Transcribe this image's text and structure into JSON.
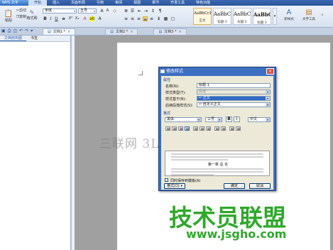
{
  "app": {
    "logo_label": "WPS 文字"
  },
  "menu": {
    "items": [
      "开始",
      "插入",
      "页面布局",
      "引用",
      "审阅",
      "视图",
      "章节",
      "开发工具",
      "特色功能"
    ],
    "active_index": 0
  },
  "ribbon": {
    "cut_label": "剪切",
    "copy_label": "复制",
    "paste_label": "粘贴",
    "format_painter_label": "格式刷",
    "font_name": "宋体",
    "font_size": "五号",
    "styles": [
      {
        "sample": "AaBbCcDt",
        "name": "正文"
      },
      {
        "sample": "AaBbC",
        "name": "标题 1"
      },
      {
        "sample": "AaBbC",
        "name": "标题 2"
      },
      {
        "sample": "AaBbC",
        "name": "标题 3"
      }
    ],
    "new_style_label": "新样式",
    "text_tools_label": "文字工具"
  },
  "tabs": {
    "items": [
      "文档1 *",
      "文档2 *",
      "文档3 *"
    ],
    "active_index": 0
  },
  "side_panel": {
    "tabs": [
      "文档结构图",
      "书签"
    ]
  },
  "dialog": {
    "title": "修改样式",
    "section_properties": "属性",
    "name_label": "名称(N):",
    "name_value": "标题 1",
    "type_label": "样式类型(T):",
    "type_value": "段落",
    "based_label": "样式基于(B):",
    "based_value": "↵ 正文",
    "next_label": "后续段落样式(S):",
    "next_value": "↵ 自定义正文",
    "section_format": "格式",
    "font_value": "黑体",
    "size_value": "三号",
    "bold_label": "B",
    "italic_label": "I",
    "lang_value": "中文",
    "preview_text": "第一章  总  论",
    "save_template_label": "同时保存到模板(A)",
    "format_button_label": "格式(O) ▾",
    "ok_label": "确定",
    "cancel_label": "取消"
  },
  "watermarks": {
    "center": "三联网 3LIAN.COM",
    "brand": "技术员联盟",
    "url": "www.jsgho.com"
  },
  "colors": {
    "accent": "#2c5599",
    "dialog_title": "#3d6fc1",
    "selection": "#316ac5",
    "brand_green": "#2fa82b"
  }
}
